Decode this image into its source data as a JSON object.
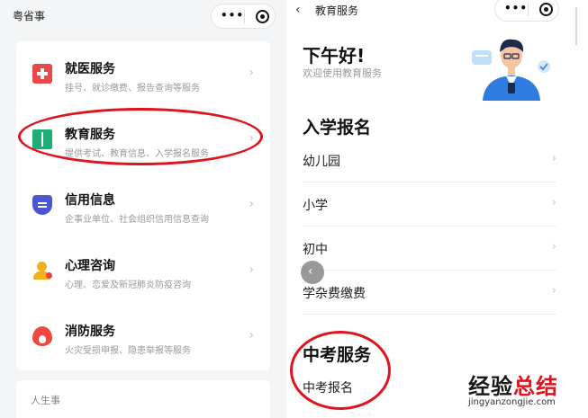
{
  "left": {
    "title": "粤省事",
    "services": [
      {
        "title": "就医服务",
        "desc": "挂号、就诊缴费、报告查询等服务",
        "icon": "medical-cross-icon"
      },
      {
        "title": "教育服务",
        "desc": "提供考试、教育信息、入学报名服务",
        "icon": "book-icon"
      },
      {
        "title": "信用信息",
        "desc": "企事业单位、社会组织信用信息查询",
        "icon": "shield-icon"
      },
      {
        "title": "心理咨询",
        "desc": "心理、恋爱及新冠肺炎防疫咨询",
        "icon": "person-icon"
      },
      {
        "title": "消防服务",
        "desc": "火灾受损申报、隐患举报等服务",
        "icon": "flame-icon"
      }
    ],
    "life_section": "人生事"
  },
  "right": {
    "title": "教育服务",
    "greeting": "下午好!",
    "welcome": "欢迎使用教育服务",
    "enroll_section": "入学报名",
    "enroll_items": [
      "幼儿园",
      "小学",
      "初中",
      "学杂费缴费"
    ],
    "exam_section": "中考服务",
    "exam_items": [
      "中考报名"
    ]
  },
  "watermark": {
    "main_a": "经验",
    "main_b": "总结",
    "sub": "jingyanzongjie.com"
  },
  "colors": {
    "highlight_red": "#e0141e",
    "medical": "#e84a4a",
    "education": "#1fae7a",
    "credit": "#4a56d6",
    "psych": "#f2b11c",
    "fire": "#f0473e"
  }
}
